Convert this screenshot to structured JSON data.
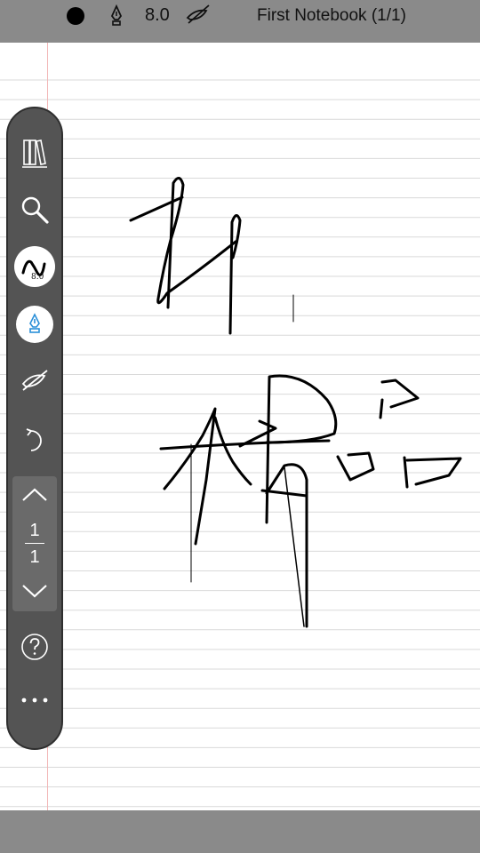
{
  "status_bar": {
    "pen_size": "8.0",
    "notebook_title": "First Notebook (1/1)",
    "pen_color": "#000000"
  },
  "toolbar": {
    "pen_size_badge": "8.0",
    "page_current": "1",
    "page_total": "1",
    "items": [
      "library-icon",
      "search-icon",
      "pen-width-button",
      "fountain-pen-icon",
      "eraser-icon",
      "undo-icon",
      "page-up-icon",
      "page-down-icon",
      "help-icon",
      "more-icon"
    ]
  },
  "colors": {
    "bars": "#8a8a8a",
    "toolbar": "#545454",
    "ruled_line": "#d9d9d9",
    "margin_line": "#f2b7b7",
    "accent": "#2a8fd8"
  }
}
